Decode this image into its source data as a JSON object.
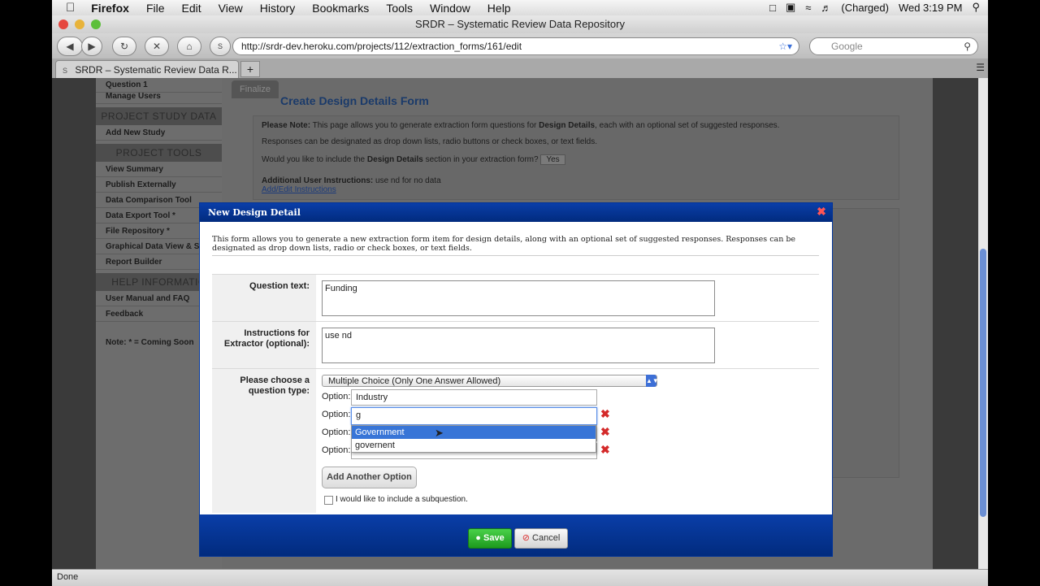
{
  "menubar": {
    "app_name": "Firefox",
    "items": [
      "File",
      "Edit",
      "View",
      "History",
      "Bookmarks",
      "Tools",
      "Window",
      "Help"
    ],
    "battery": "(Charged)",
    "clock": "Wed 3:19 PM"
  },
  "window": {
    "title": "SRDR – Systematic Review Data Repository"
  },
  "toolbar": {
    "url": "http://srdr-dev.heroku.com/projects/112/extraction_forms/161/edit",
    "search_placeholder": "Google"
  },
  "tabs": [
    {
      "label": "SRDR – Systematic Review Data R..."
    }
  ],
  "sidebar": {
    "top_items": [
      "Question 1",
      "Manage Users"
    ],
    "heading_study": "PROJECT STUDY DATA",
    "study_items": [
      "Add New Study"
    ],
    "heading_tools": "PROJECT TOOLS",
    "tool_items": [
      "View Summary",
      "Publish Externally",
      "Data Comparison Tool",
      "Data Export Tool *",
      "File Repository *",
      "Graphical Data View & S",
      "Report Builder"
    ],
    "heading_help": "HELP INFORMATIO",
    "help_items": [
      "User Manual and FAQ",
      "Feedback"
    ],
    "note": "Note: * = Coming Soon"
  },
  "page": {
    "finalize_tab": "Finalize",
    "heading": "Create Design Details Form",
    "note_label": "Please Note:",
    "note_text_a": "This page allows you to generate extraction form questions for",
    "note_bold": "Design Details",
    "note_text_b": ", each with an optional set of suggested responses.",
    "responses_text": "Responses can be designated as drop down lists, radio buttons or check boxes, or text fields.",
    "include_q_a": "Would you like to include the",
    "include_q_bold": "Design Details",
    "include_q_b": "section in your extraction form?",
    "include_value": "Yes",
    "instructions_label": "Additional User Instructions:",
    "instructions_value": "use nd for no data",
    "edit_link": "Add/Edit Instructions"
  },
  "modal": {
    "title": "New Design Detail",
    "description": "This form allows you to generate a new extraction form item for design details, along with an optional set of suggested responses. Responses can be designated as drop down lists, radio or check boxes, or text fields.",
    "question_label": "Question text:",
    "question_value": "Funding",
    "instructions_label": "Instructions for Extractor (optional):",
    "instructions_value": "use nd",
    "type_label": "Please choose a question type:",
    "type_value": "Multiple Choice (Only One Answer Allowed)",
    "option_label": "Option:",
    "options": [
      "Industry",
      "g",
      "",
      ""
    ],
    "autocomplete": [
      "Government",
      "governent"
    ],
    "add_option": "Add Another Option",
    "subquestion": "I would like to include a subquestion.",
    "save": "Save",
    "cancel": "Cancel"
  },
  "status": "Done"
}
